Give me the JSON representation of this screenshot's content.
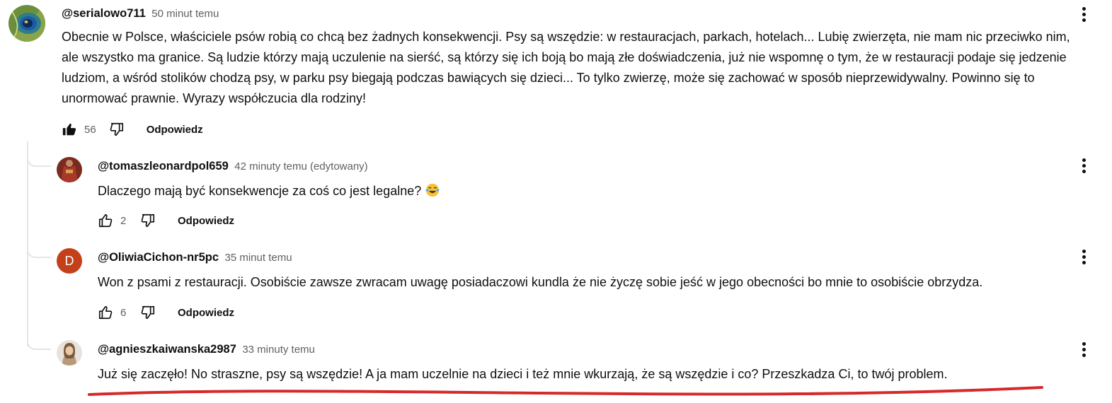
{
  "comments": [
    {
      "handle": "@serialowo711",
      "time": "50 minut temu",
      "text": "Obecnie w Polsce, właściciele psów robią co chcą bez żadnych konsekwencji. Psy są wszędzie: w restauracjach, parkach, hotelach... Lubię zwierzęta, nie mam nic przeciwko nim, ale wszystko ma granice. Są ludzie którzy mają uczulenie na sierść, są którzy się ich boją bo mają złe doświadczenia, już nie wspomnę o tym, że w restauracji podaje się jedzenie ludziom, a wśród stolików chodzą psy, w parku psy biegają podczas bawiących się dzieci... To tylko zwierzę, może się zachować w sposób nieprzewidywalny.  Powinno się to unormować prawnie. Wyrazy współczucia dla rodziny!",
      "likes": "56",
      "liked": true,
      "reply_label": "Odpowiedz"
    }
  ],
  "replies": [
    {
      "handle": "@tomaszleonardpol659",
      "time": "42 minuty temu (edytowany)",
      "text": "Dlaczego mają być konsekwencje za coś co jest legalne?",
      "emoji": "face-with-tears-of-joy",
      "likes": "2",
      "reply_label": "Odpowiedz"
    },
    {
      "handle": "@OliwiaCichon-nr5pc",
      "time": "35 minut temu",
      "text": "Won z psami z restauracji. Osobiście zawsze zwracam uwagę posiadaczowi kundla że nie życzę sobie jeść w jego obecności bo mnie to osobiście obrzydza.",
      "avatar_letter": "D",
      "avatar_color": "#c4401a",
      "likes": "6",
      "reply_label": "Odpowiedz"
    },
    {
      "handle": "@agnieszkaiwanska2987",
      "time": "33 minuty temu",
      "text": "Już się zaczęło! No straszne, psy są wszędzie! A ja mam uczelnie na dzieci i też mnie wkurzają, że są wszędzie i co? Przeszkadza Ci, to twój problem."
    }
  ],
  "annotation_color": "#d42a2a"
}
